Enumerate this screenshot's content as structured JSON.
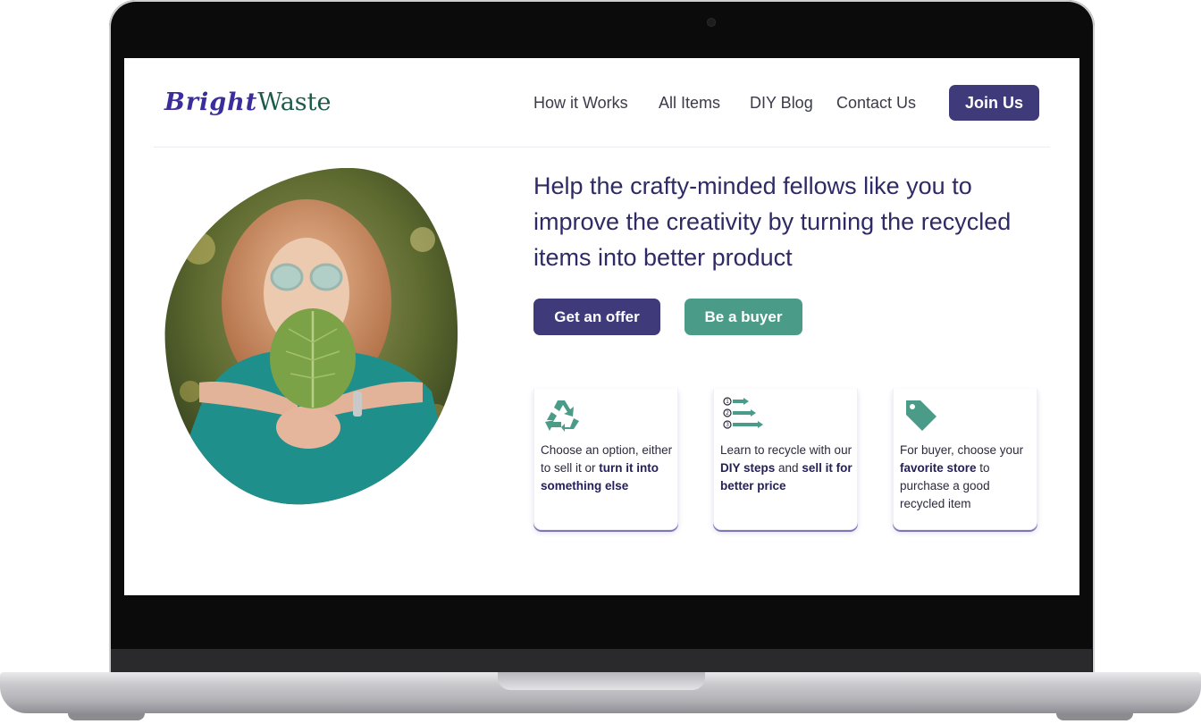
{
  "brand": {
    "part1": "Bright",
    "part2": "Waste"
  },
  "nav": {
    "items": [
      "How it Works",
      "All Items",
      "DIY Blog",
      "Contact Us"
    ],
    "cta": "Join Us"
  },
  "hero": {
    "headline": "Help the crafty-minded fellows like you to improve the creativity by turning the recycled items into better product",
    "primary_button": "Get an offer",
    "secondary_button": "Be a buyer",
    "image_icon": "woman-holding-leaf-photo"
  },
  "cards": [
    {
      "icon": "recycle-icon",
      "t1": "Choose an option, either to sell it or ",
      "b1": "turn it into something else",
      "t2": "",
      "b2": "",
      "t3": ""
    },
    {
      "icon": "numbered-steps-icon",
      "t1": "Learn to recycle with our ",
      "b1": "DIY steps",
      "t2": " and ",
      "b2": "sell it for better price",
      "t3": ""
    },
    {
      "icon": "price-tag-icon",
      "t1": "For buyer, choose your ",
      "b1": "favorite store",
      "t2": " to purchase a good recycled item",
      "b2": "",
      "t3": ""
    }
  ],
  "colors": {
    "primary": "#3f3a79",
    "secondary": "#4a9b87",
    "heading": "#2e2a66"
  }
}
